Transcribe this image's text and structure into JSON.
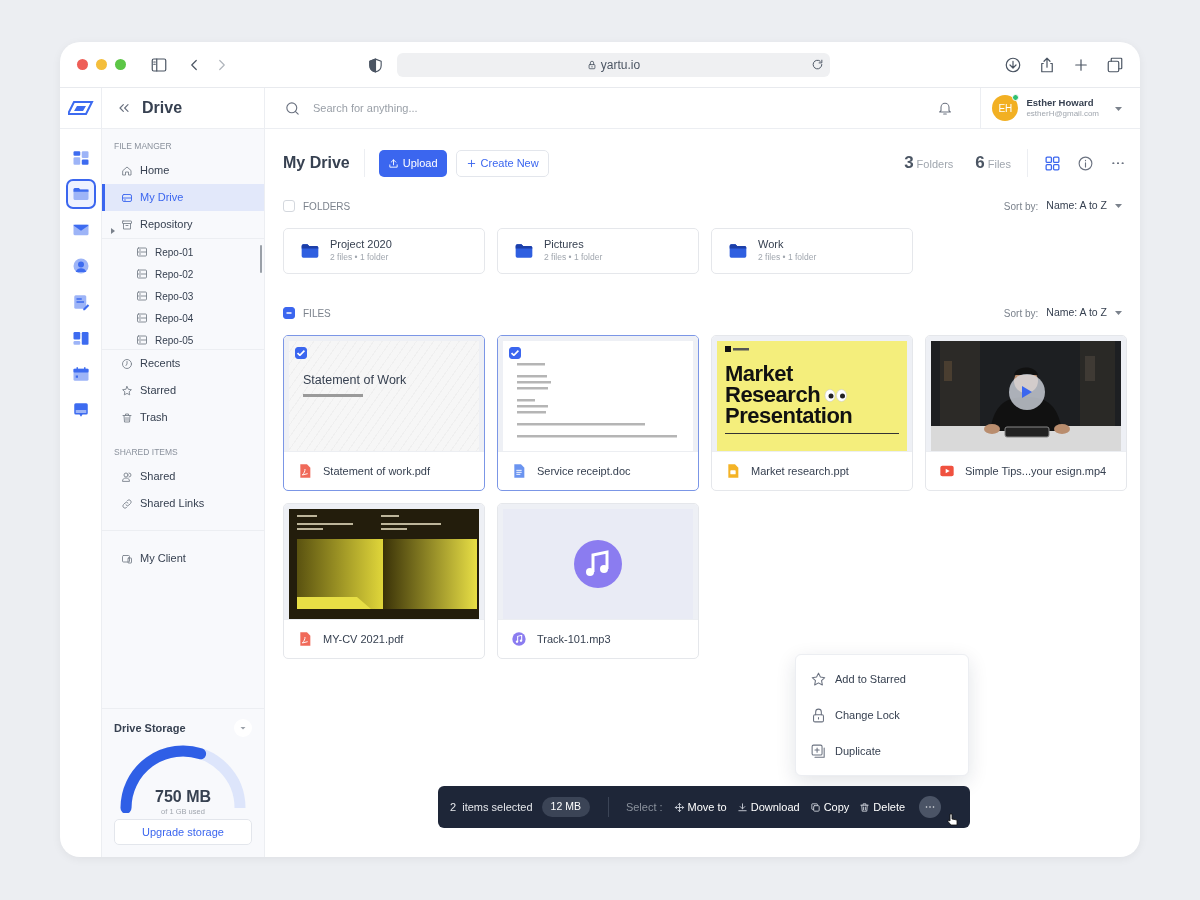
{
  "browser": {
    "url": "yartu.io"
  },
  "rail": [
    {
      "kind": "dashboard",
      "selected": false
    },
    {
      "kind": "folder",
      "selected": true
    },
    {
      "kind": "mail",
      "selected": false
    },
    {
      "kind": "contacts",
      "selected": false
    },
    {
      "kind": "notes",
      "selected": false
    },
    {
      "kind": "boards",
      "selected": false
    },
    {
      "kind": "calendar",
      "selected": false
    },
    {
      "kind": "chat",
      "selected": false
    }
  ],
  "header": {
    "title": "Drive",
    "search": {
      "placeholder": "Search for anything..."
    },
    "user": {
      "initials": "EH",
      "name": "Esther Howard",
      "email": "estherH@gmail.com",
      "online": true
    }
  },
  "sidebar": {
    "sections": [
      {
        "heading": "FILE MANGER",
        "items": [
          {
            "label": "Home",
            "selected": false
          },
          {
            "label": "My Drive",
            "selected": true
          },
          {
            "label": "Repository",
            "selected": false,
            "children": [
              {
                "label": "Repo-01"
              },
              {
                "label": "Repo-02"
              },
              {
                "label": "Repo-03"
              },
              {
                "label": "Repo-04"
              },
              {
                "label": "Repo-05"
              }
            ]
          },
          {
            "label": "Recents",
            "selected": false
          },
          {
            "label": "Starred",
            "selected": false
          },
          {
            "label": "Trash",
            "selected": false
          }
        ]
      },
      {
        "heading": "SHARED ITEMS",
        "items": [
          {
            "label": "Shared",
            "selected": false
          },
          {
            "label": "Shared Links",
            "selected": false
          }
        ]
      },
      {
        "items": [
          {
            "label": "My Client",
            "selected": false
          }
        ]
      }
    ]
  },
  "storage": {
    "title": "Drive Storage",
    "amount": "750 MB",
    "caption": "of 1 GB used",
    "button": "Upgrade storage"
  },
  "main": {
    "title": "My Drive",
    "upload": "Upload",
    "create": "Create New",
    "counts": [
      {
        "value": "3",
        "label": "Folders"
      },
      {
        "value": "6",
        "label": "Files"
      }
    ],
    "folders": {
      "heading": "FOLDERS",
      "checked": false,
      "indeterminate": false,
      "sort_label": "Sort by:",
      "sort_value": "Name: A to Z",
      "items": [
        {
          "name": "Project 2020",
          "meta": "2 files • 1 folder"
        },
        {
          "name": "Pictures",
          "meta": "2 files • 1 folder"
        },
        {
          "name": "Work",
          "meta": "2 files • 1 folder"
        }
      ]
    },
    "files": {
      "heading": "FILES",
      "indeterminate": true,
      "sort_label": "Sort by:",
      "sort_value": "Name: A to Z",
      "items": [
        {
          "name": "Statement of work.pdf",
          "kind": "pdf",
          "selected": true,
          "preview": {
            "kind": "document",
            "title": "Statement of Work"
          }
        },
        {
          "name": "Service receipt.doc",
          "kind": "doc",
          "selected": true,
          "preview": {
            "kind": "receipt"
          }
        },
        {
          "name": "Market research.ppt",
          "kind": "ppt",
          "selected": false,
          "preview": {
            "kind": "slide",
            "title_lines": [
              "Market",
              "Research",
              "Presentation"
            ]
          }
        },
        {
          "name": "Simple Tips...your esign.mp4",
          "kind": "video",
          "selected": false
        },
        {
          "name": "MY-CV 2021.pdf",
          "kind": "pdf",
          "selected": false,
          "preview": {
            "kind": "cv"
          }
        },
        {
          "name": "Track-101.mp3",
          "kind": "audio",
          "selected": false,
          "preview": {
            "kind": "audio"
          }
        }
      ]
    }
  },
  "context_menu": [
    {
      "label": "Add to Starred"
    },
    {
      "label": "Change Lock"
    },
    {
      "label": "Duplicate"
    }
  ],
  "selection_bar": {
    "summary": "2  items selected",
    "size": "12 MB",
    "select_label": "Select :",
    "actions": [
      "Move to",
      "Download",
      "Copy",
      "Delete"
    ]
  }
}
